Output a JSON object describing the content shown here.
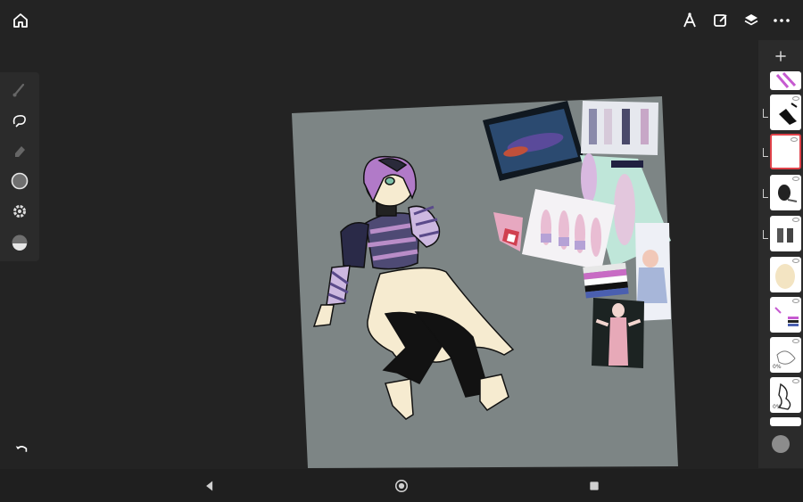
{
  "app": {
    "toolbar": {
      "icons": [
        "home-icon",
        "ruler-compass-icon",
        "edit-square-icon",
        "layers-icon",
        "more-icon"
      ]
    },
    "left_tools": [
      "brush-icon",
      "lasso-icon",
      "eraser-icon",
      "color-ring-icon",
      "settings-icon",
      "opacity-icon"
    ],
    "undo_icon": "undo-icon",
    "layers": [
      {
        "name": "layer-1",
        "pct": "",
        "selected": false
      },
      {
        "name": "layer-2",
        "pct": "",
        "selected": false
      },
      {
        "name": "layer-3",
        "pct": "",
        "selected": true
      },
      {
        "name": "layer-4",
        "pct": "",
        "selected": false
      },
      {
        "name": "layer-5",
        "pct": "",
        "selected": false
      },
      {
        "name": "layer-6",
        "pct": "",
        "selected": false
      },
      {
        "name": "layer-7",
        "pct": "",
        "selected": false
      },
      {
        "name": "layer-8",
        "pct": "0%",
        "selected": false
      },
      {
        "name": "layer-9",
        "pct": "0%",
        "selected": false
      }
    ],
    "colors": {
      "background": "#232323",
      "panel": "#2b2b2b",
      "canvas": "#7d8585",
      "selected_layer_border": "#e0424a",
      "brush_color": "#8c8c8c"
    },
    "nav": [
      "back-icon",
      "home-nav-icon",
      "recents-icon"
    ]
  }
}
